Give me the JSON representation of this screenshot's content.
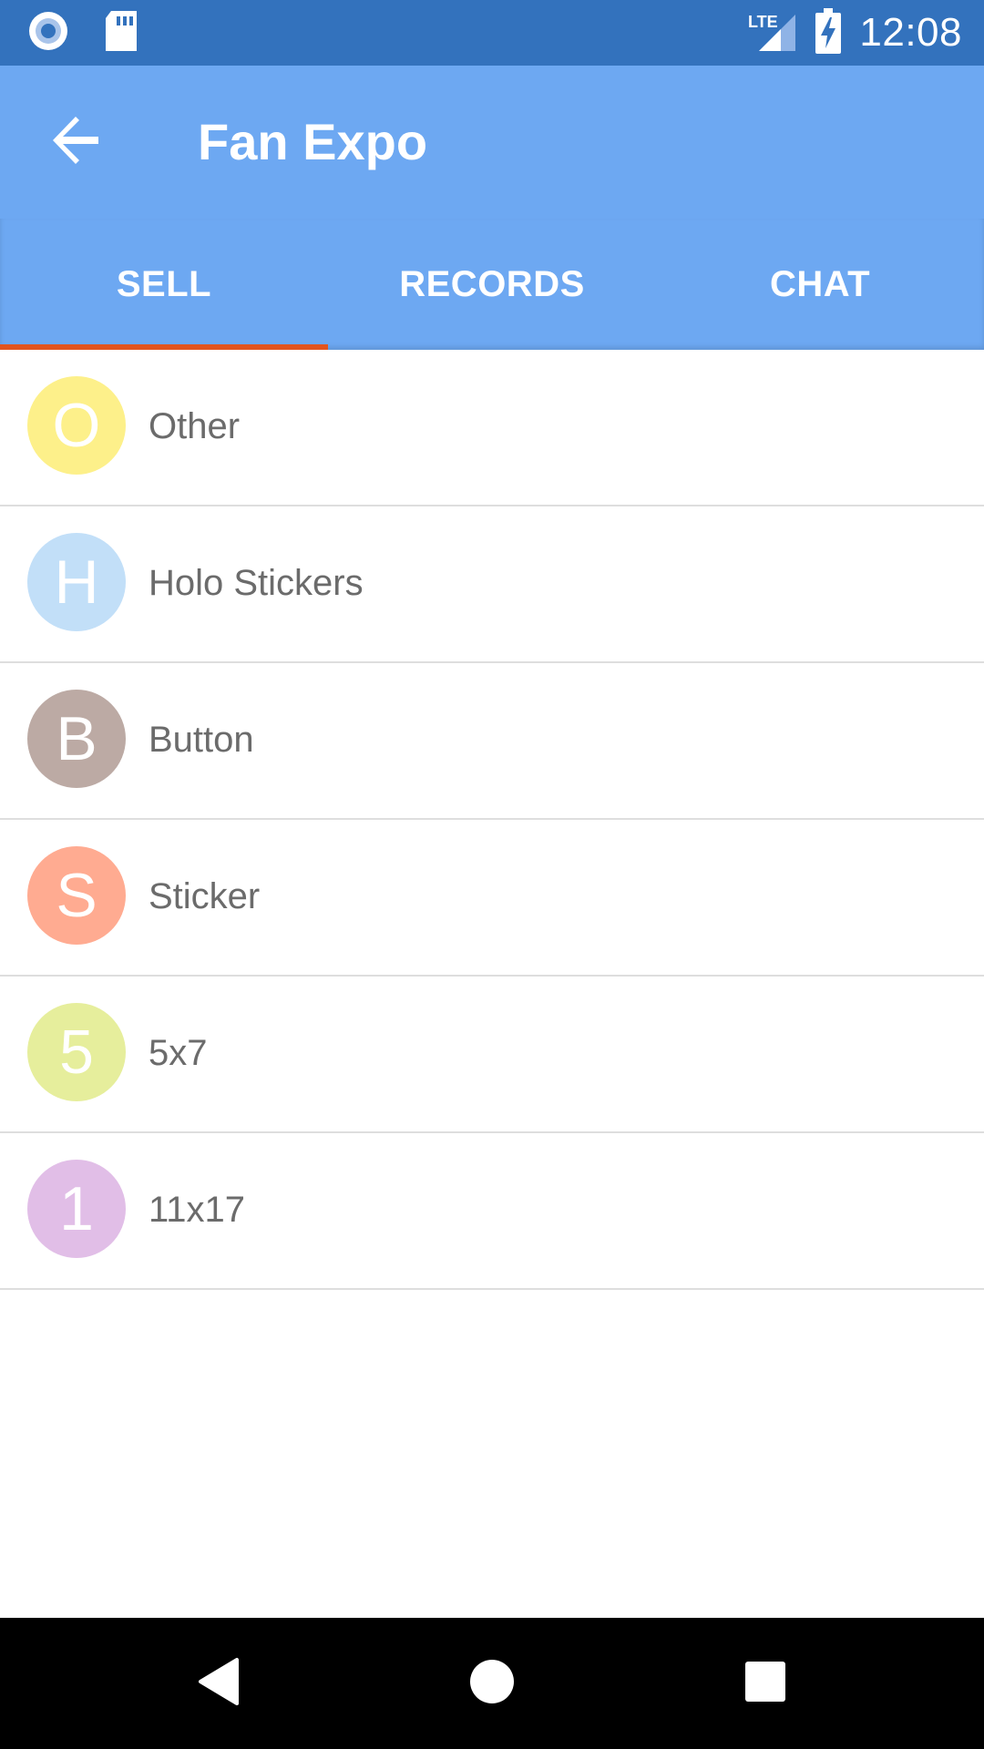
{
  "status_bar": {
    "time": "12:08",
    "network": "LTE",
    "background": "#3372bd",
    "icons": [
      "record-icon",
      "sd-card-icon",
      "lte-signal-icon",
      "battery-charging-icon"
    ]
  },
  "app_bar": {
    "title": "Fan Expo",
    "back_icon": "arrow-back-icon",
    "background": "#6da8f2"
  },
  "tabs": [
    {
      "label": "SELL",
      "selected": true
    },
    {
      "label": "RECORDS",
      "selected": false
    },
    {
      "label": "CHAT",
      "selected": false
    }
  ],
  "tab_indicator_color": "#e2541e",
  "items": [
    {
      "initial": "O",
      "label": "Other",
      "color": "#fdf08a"
    },
    {
      "initial": "H",
      "label": "Holo Stickers",
      "color": "#c2dff8"
    },
    {
      "initial": "B",
      "label": "Button",
      "color": "#bcaaa4"
    },
    {
      "initial": "S",
      "label": "Sticker",
      "color": "#ffab91"
    },
    {
      "initial": "5",
      "label": "5x7",
      "color": "#e6ee9c"
    },
    {
      "initial": "1",
      "label": "11x17",
      "color": "#e1bee7"
    }
  ],
  "nav_bar": {
    "buttons": [
      "back-triangle-icon",
      "home-circle-icon",
      "recents-square-icon"
    ]
  }
}
